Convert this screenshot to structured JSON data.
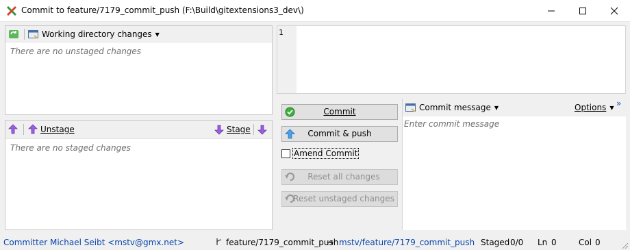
{
  "window": {
    "title": "Commit to feature/7179_commit_push (F:\\Build\\gitextensions3_dev\\)"
  },
  "unstaged": {
    "toolbar_label": "Working directory changes",
    "empty_text": "There are no unstaged changes"
  },
  "staged": {
    "unstage_label": "Unstage",
    "stage_label": "Stage",
    "empty_text": "There are no staged changes"
  },
  "diff": {
    "line_number": "1"
  },
  "actions": {
    "commit": "Commit",
    "commit_push": "Commit & push",
    "amend": "Amend Commit",
    "amend_checked": false,
    "reset_all": "Reset all changes",
    "reset_unstaged": "Reset unstaged changes"
  },
  "message": {
    "label": "Commit message",
    "options": "Options",
    "placeholder": "Enter commit message",
    "chevron": "»"
  },
  "status": {
    "committer": "Committer Michael Seibt <mstv@gmx.net>",
    "branch": "feature/7179_commit_push",
    "arrow": "→",
    "remote": "mstv/feature/7179_commit_push",
    "staged_label": "Staged",
    "staged_value": "0/0",
    "ln_label": "Ln",
    "ln_value": "0",
    "col_label": "Col",
    "col_value": "0"
  },
  "colors": {
    "accent_link": "#0645ad",
    "stage_arrow": "#8c4fd6",
    "commit_ok": "#3db03d"
  }
}
